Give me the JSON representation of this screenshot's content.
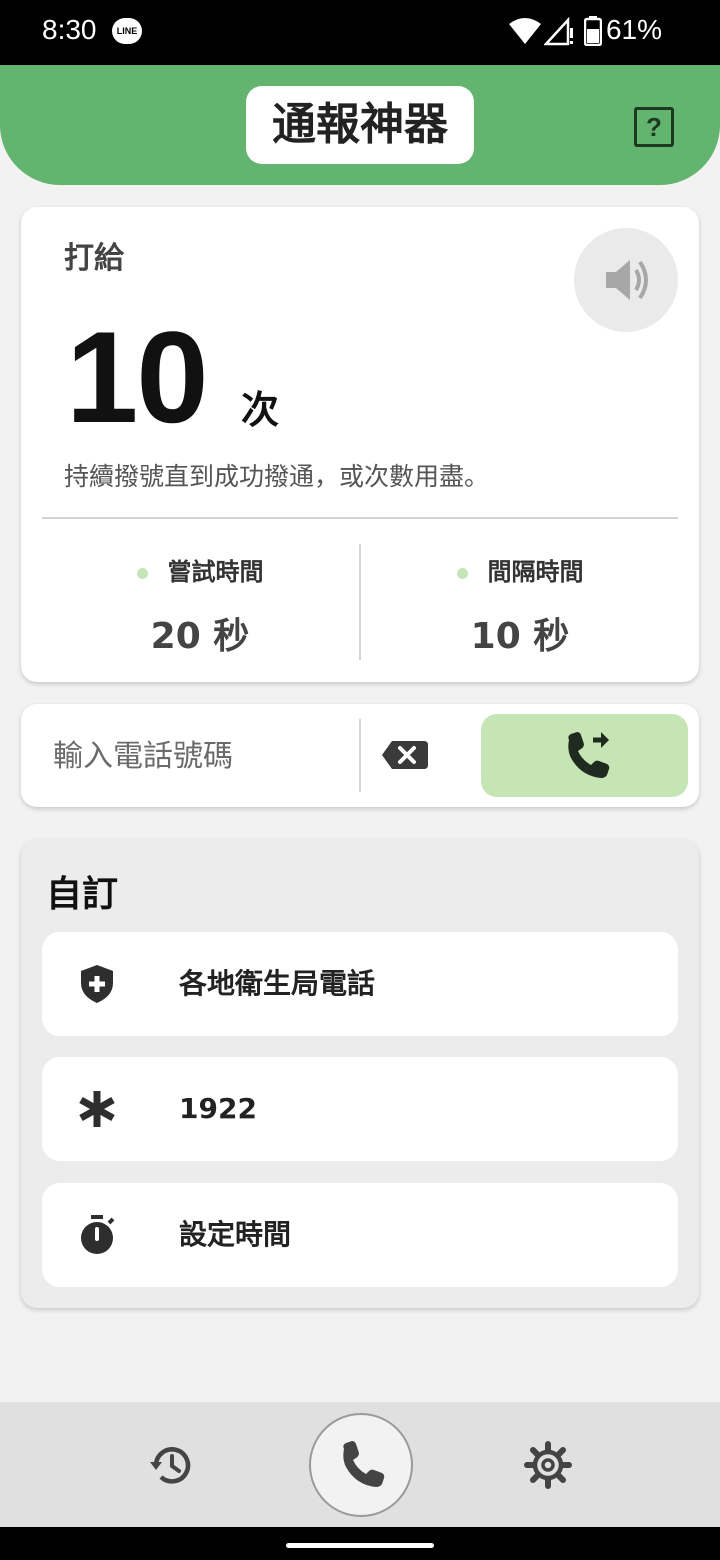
{
  "status_bar": {
    "time": "8:30",
    "notification_app": "LINE",
    "battery": "61%"
  },
  "header": {
    "title": "通報神器",
    "help_icon": "help-square-icon",
    "help_label": "?"
  },
  "call_card": {
    "label": "打給",
    "count": "10",
    "count_unit": "次",
    "description": "持續撥號直到成功撥通，或次數用盡。",
    "speaker_icon": "speaker-icon",
    "stats": [
      {
        "label": "嘗試時間",
        "value": "20 秒"
      },
      {
        "label": "間隔時間",
        "value": "10 秒"
      }
    ]
  },
  "phone_input": {
    "placeholder": "輸入電話號碼",
    "backspace_icon": "backspace-icon",
    "dial_icon": "phone-forward-icon"
  },
  "custom": {
    "title": "自訂",
    "items": [
      {
        "label": "各地衛生局電話",
        "icon": "shield-plus-icon"
      },
      {
        "label": "1922",
        "icon": "asterisk-icon"
      },
      {
        "label": "設定時間",
        "icon": "timer-icon"
      }
    ]
  },
  "bottom_nav": {
    "items": [
      {
        "icon": "history-icon"
      },
      {
        "icon": "phone-icon"
      },
      {
        "icon": "settings-gear-icon"
      }
    ]
  },
  "colors": {
    "header_green": "#62b46e",
    "dial_green": "#c5e5b5",
    "dot_green": "#c5e5b8"
  }
}
